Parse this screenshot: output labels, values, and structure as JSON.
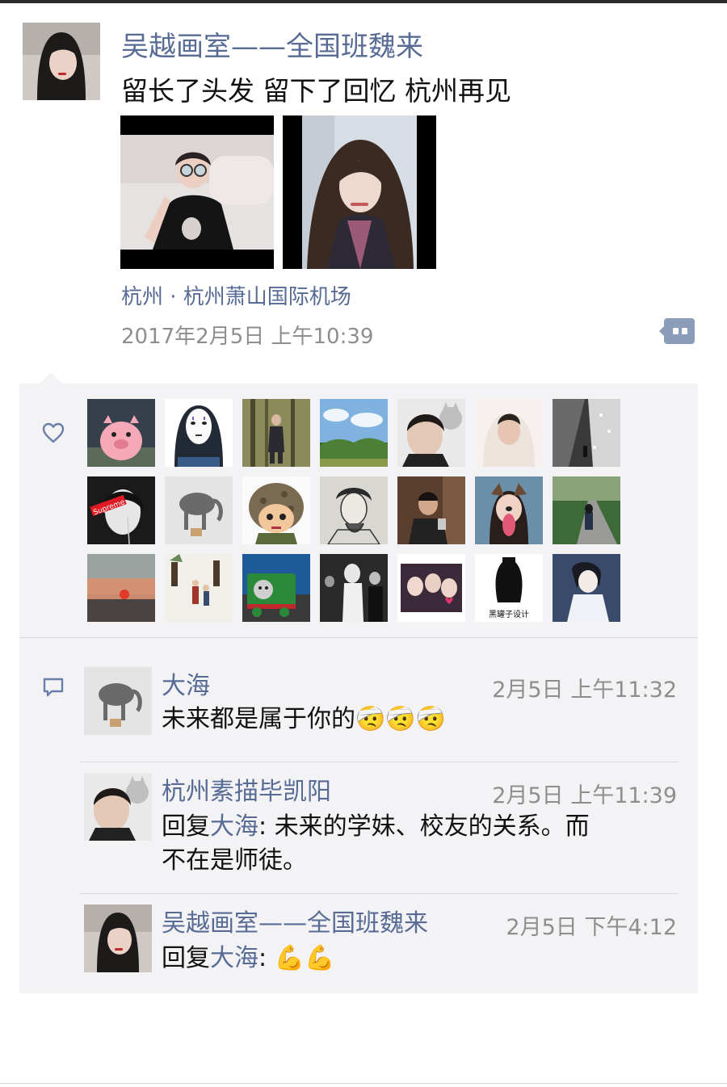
{
  "post": {
    "author": "吴越画室——全国班魏来",
    "text": "留长了头发 留下了回忆 杭州再见",
    "location": "杭州 · 杭州萧山国际机场",
    "timestamp": "2017年2月5日 上午10:39"
  },
  "likes": {
    "icon": "heart-icon",
    "count_visible": 21
  },
  "comments": [
    {
      "name": "大海",
      "time": "2月5日 上午11:32",
      "text": "未来都是属于你的",
      "emoji": "🤕🤕🤕"
    },
    {
      "name": "杭州素描毕凯阳",
      "time": "2月5日 上午11:39",
      "reply_prefix": "回复",
      "reply_to": "大海",
      "line1": ": 未来的学妹、校友的关系。而",
      "line2": "不在是师徒。"
    },
    {
      "name": "吴越画室——全国班魏来",
      "time": "2月5日 下午4:12",
      "reply_prefix": "回复",
      "reply_to": "大海",
      "text": ": ",
      "emoji": "💪💪"
    }
  ],
  "liker_thumbs": {
    "thumb_17_caption": "黑罐子设计"
  },
  "colors": {
    "link": "#576b95",
    "panel": "#f3f3f5",
    "meta": "#8e8e8e",
    "text": "#111111"
  }
}
